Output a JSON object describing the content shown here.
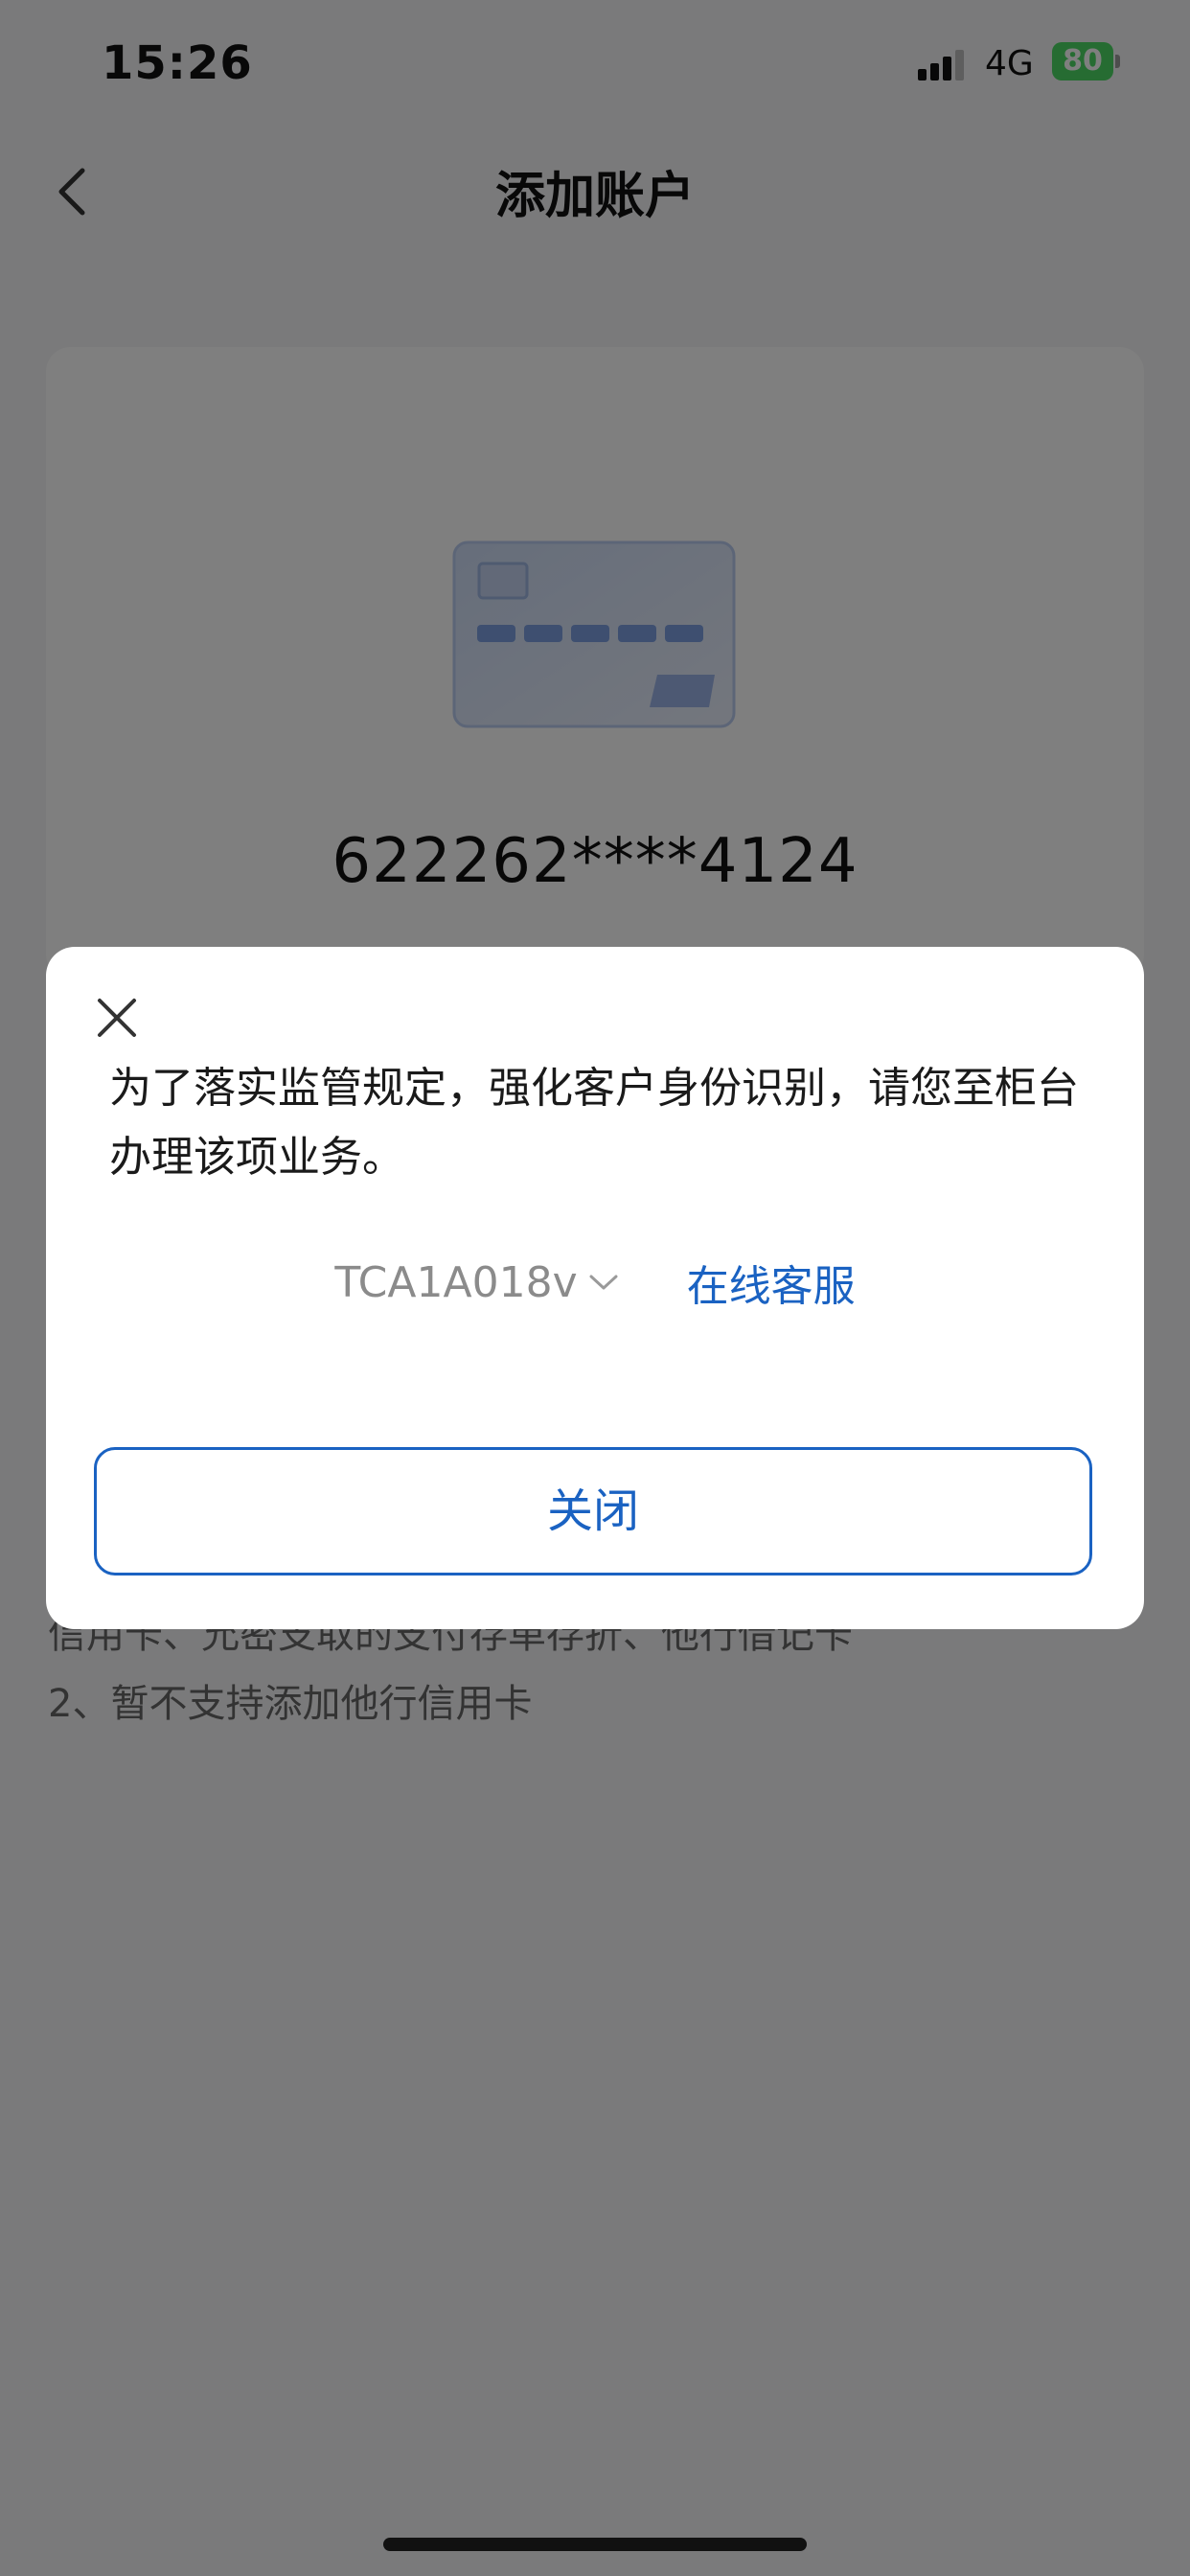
{
  "status_bar": {
    "time": "15:26",
    "network": "4G",
    "battery": "80",
    "battery_color": "#4cd964",
    "icons": [
      "signal-icon",
      "charging-icon"
    ]
  },
  "nav": {
    "title": "添加账户",
    "back_icon": "chevron-left-icon"
  },
  "card": {
    "icon": "bank-card-icon",
    "number": "622262****4124"
  },
  "notes": {
    "line1": "信用卡、允密支取的支付存单存折、他行借记卡",
    "line2": "2、暂不支持添加他行信用卡"
  },
  "dialog": {
    "message": "为了落实监管规定，强化客户身份识别，请您至柜台办理该项业务。",
    "code": "TCA1A018v",
    "code_icon": "chevron-down-icon",
    "customer_service": "在线客服",
    "close_button": "关闭",
    "close_icon": "close-icon",
    "accent_color": "#1a62c2"
  }
}
